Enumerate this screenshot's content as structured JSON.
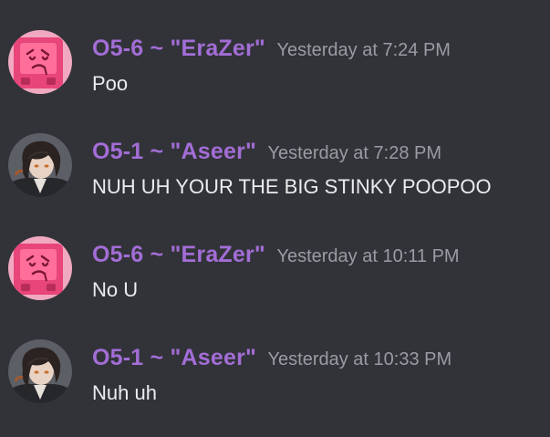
{
  "messages": [
    {
      "author": "O5-6 ~ \"EraZer\"",
      "avatar_icon": "pink-cartoon-face-avatar-icon",
      "timestamp": "Yesterday at 7:24 PM",
      "content": "Poo"
    },
    {
      "author": "O5-1 ~ \"Aseer\"",
      "avatar_icon": "dark-haired-character-avatar-icon",
      "timestamp": "Yesterday at 7:28 PM",
      "content": "NUH UH YOUR THE BIG STINKY POOPOO"
    },
    {
      "author": "O5-6 ~ \"EraZer\"",
      "avatar_icon": "pink-cartoon-face-avatar-icon",
      "timestamp": "Yesterday at 10:11 PM",
      "content": "No U"
    },
    {
      "author": "O5-1 ~ \"Aseer\"",
      "avatar_icon": "dark-haired-character-avatar-icon",
      "timestamp": "Yesterday at 10:33 PM",
      "content": "Nuh uh"
    }
  ],
  "colors": {
    "background": "#313338",
    "username": "#a36dd6",
    "timestamp": "#9a9ca3",
    "message_text": "#ececee",
    "pink_avatar": "#e8457a"
  }
}
